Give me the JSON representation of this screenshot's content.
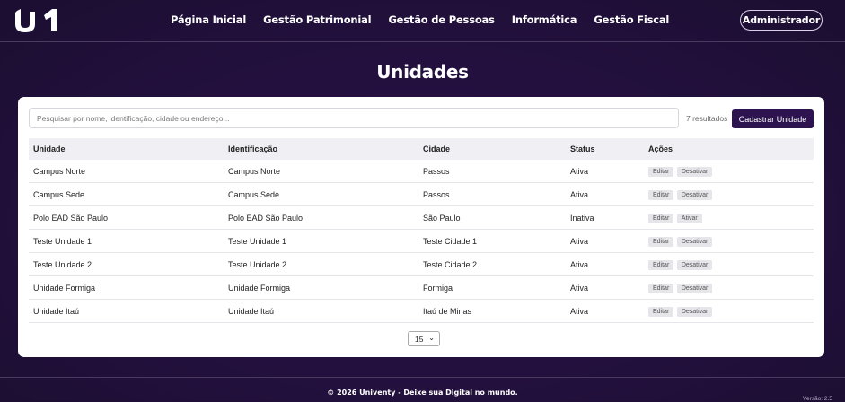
{
  "brand": {
    "logo_text": "U1"
  },
  "nav": {
    "items": [
      {
        "label": "Página Inicial"
      },
      {
        "label": "Gestão Patrimonial"
      },
      {
        "label": "Gestão de Pessoas"
      },
      {
        "label": "Informática"
      },
      {
        "label": "Gestão Fiscal"
      }
    ],
    "user_label": "Administrador"
  },
  "page": {
    "title": "Unidades"
  },
  "toolbar": {
    "search_placeholder": "Pesquisar por nome, identificação, cidade ou endereço...",
    "search_value": "",
    "results_count": "7 resultados",
    "create_label": "Cadastrar Unidade"
  },
  "table": {
    "headers": [
      "Unidade",
      "Identificação",
      "Cidade",
      "Status",
      "Ações"
    ],
    "rows": [
      {
        "unidade": "Campus Norte",
        "identificacao": "Campus Norte",
        "cidade": "Passos",
        "status": "Ativa",
        "edit": "Editar",
        "toggle": "Desativar"
      },
      {
        "unidade": "Campus Sede",
        "identificacao": "Campus Sede",
        "cidade": "Passos",
        "status": "Ativa",
        "edit": "Editar",
        "toggle": "Desativar"
      },
      {
        "unidade": "Polo EAD São Paulo",
        "identificacao": "Polo EAD São Paulo",
        "cidade": "São Paulo",
        "status": "Inativa",
        "edit": "Editar",
        "toggle": "Ativar"
      },
      {
        "unidade": "Teste Unidade 1",
        "identificacao": "Teste Unidade 1",
        "cidade": "Teste Cidade 1",
        "status": "Ativa",
        "edit": "Editar",
        "toggle": "Desativar"
      },
      {
        "unidade": "Teste Unidade 2",
        "identificacao": "Teste Unidade 2",
        "cidade": "Teste Cidade 2",
        "status": "Ativa",
        "edit": "Editar",
        "toggle": "Desativar"
      },
      {
        "unidade": "Unidade Formiga",
        "identificacao": "Unidade Formiga",
        "cidade": "Formiga",
        "status": "Ativa",
        "edit": "Editar",
        "toggle": "Desativar"
      },
      {
        "unidade": "Unidade Itaú",
        "identificacao": "Unidade Itaú",
        "cidade": "Itaú de Minas",
        "status": "Ativa",
        "edit": "Editar",
        "toggle": "Desativar"
      }
    ]
  },
  "pagination": {
    "page_size": "15"
  },
  "footer": {
    "text": "© 2026 Univenty - Deixe sua Digital no mundo.",
    "version": "Versão: 2.5"
  },
  "colors": {
    "background": "#22103c",
    "accent": "#2d1450",
    "card": "#ffffff"
  }
}
